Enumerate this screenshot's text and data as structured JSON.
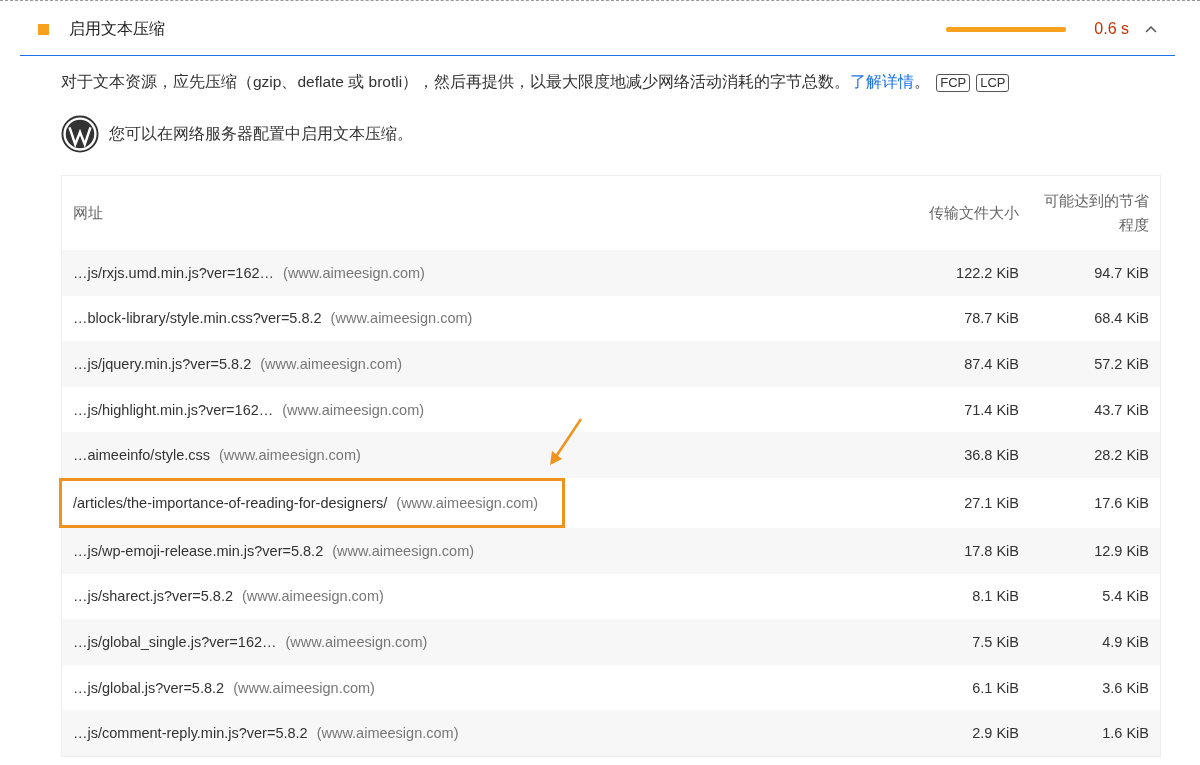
{
  "audit": {
    "title": "启用文本压缩",
    "value": "0.6 s",
    "expanded": true,
    "description": "对于文本资源，应先压缩（gzip、deflate 或 brotli），然后再提供，以最大限度地减少网络活动消耗的字节总数。",
    "link": "了解详情",
    "after_link": "。",
    "tags": [
      "FCP",
      "LCP"
    ],
    "hint": "您可以在网络服务器配置中启用文本压缩。"
  },
  "table": {
    "columns": [
      "网址",
      "传输文件大小",
      "可能达到的节省程度"
    ],
    "rows": [
      {
        "url": "…js/rxjs.umd.min.js?ver=162…",
        "host": "(www.aimeesign.com)",
        "size": "122.2 KiB",
        "savings": "94.7 KiB",
        "highlighted": false
      },
      {
        "url": "…block-library/style.min.css?ver=5.8.2",
        "host": "(www.aimeesign.com)",
        "size": "78.7 KiB",
        "savings": "68.4 KiB",
        "highlighted": false
      },
      {
        "url": "…js/jquery.min.js?ver=5.8.2",
        "host": "(www.aimeesign.com)",
        "size": "87.4 KiB",
        "savings": "57.2 KiB",
        "highlighted": false
      },
      {
        "url": "…js/highlight.min.js?ver=162…",
        "host": "(www.aimeesign.com)",
        "size": "71.4 KiB",
        "savings": "43.7 KiB",
        "highlighted": false
      },
      {
        "url": "…aimeeinfo/style.css",
        "host": "(www.aimeesign.com)",
        "size": "36.8 KiB",
        "savings": "28.2 KiB",
        "highlighted": false
      },
      {
        "url": "/articles/the-importance-of-reading-for-designers/",
        "host": "(www.aimeesign.com)",
        "size": "27.1 KiB",
        "savings": "17.6 KiB",
        "highlighted": true
      },
      {
        "url": "…js/wp-emoji-release.min.js?ver=5.8.2",
        "host": "(www.aimeesign.com)",
        "size": "17.8 KiB",
        "savings": "12.9 KiB",
        "highlighted": false
      },
      {
        "url": "…js/sharect.js?ver=5.8.2",
        "host": "(www.aimeesign.com)",
        "size": "8.1 KiB",
        "savings": "5.4 KiB",
        "highlighted": false
      },
      {
        "url": "…js/global_single.js?ver=162…",
        "host": "(www.aimeesign.com)",
        "size": "7.5 KiB",
        "savings": "4.9 KiB",
        "highlighted": false
      },
      {
        "url": "…js/global.js?ver=5.8.2",
        "host": "(www.aimeesign.com)",
        "size": "6.1 KiB",
        "savings": "3.6 KiB",
        "highlighted": false
      },
      {
        "url": "…js/comment-reply.min.js?ver=5.8.2",
        "host": "(www.aimeesign.com)",
        "size": "2.9 KiB",
        "savings": "1.6 KiB",
        "highlighted": false
      }
    ]
  }
}
